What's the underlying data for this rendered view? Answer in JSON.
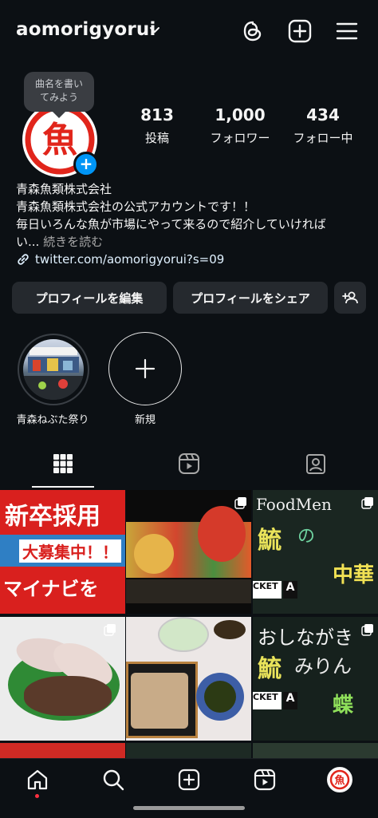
{
  "header": {
    "username": "aomorigyorui"
  },
  "tooltip": {
    "line1": "曲名を書い",
    "line2": "てみよう"
  },
  "avatar": {
    "glyph": "魚"
  },
  "stats": [
    {
      "num": "813",
      "label": "投稿"
    },
    {
      "num": "1,000",
      "label": "フォロワー"
    },
    {
      "num": "434",
      "label": "フォロー中"
    }
  ],
  "bio": {
    "name": "青森魚類株式会社",
    "line1": "青森魚類株式会社の公式アカウントです！！",
    "line2": "毎日いろんな魚が市場にやって来るので紹介していければ",
    "line3_prefix": "い...",
    "more": "続きを読む",
    "link": "twitter.com/aomorigyorui?s=09"
  },
  "buttons": {
    "edit": "プロフィールを編集",
    "share": "プロフィールをシェア"
  },
  "highlights": [
    {
      "label": "青森ねぶた祭り"
    },
    {
      "label": "新規"
    }
  ],
  "grid_texts": {
    "c1_top": "新卒採用",
    "c1_mid": "大募集中！！",
    "c1_bot": "マイナビを",
    "c3_top": "FoodMen",
    "c3_a": "A",
    "c3_chinese": "中華",
    "c3_ticket": "CKET",
    "c6_ticket": "CKET"
  },
  "colors": {
    "bg": "#0c1014",
    "button": "#25292e",
    "accent_blue": "#0095f6",
    "brand_red": "#e1251b",
    "notif_red": "#ff3040"
  },
  "icons": [
    "chevron-down-icon",
    "threads-icon",
    "plus-square-icon",
    "menu-icon",
    "link-icon",
    "add-person-icon",
    "plus-icon",
    "grid-icon",
    "reels-icon",
    "tagged-icon",
    "home-icon",
    "search-icon",
    "create-icon",
    "reels-nav-icon",
    "profile-avatar-icon"
  ]
}
